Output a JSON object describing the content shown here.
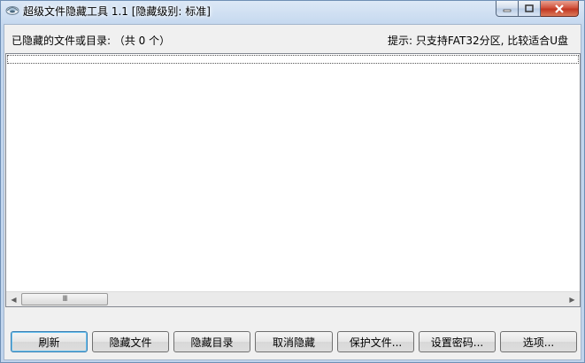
{
  "window": {
    "title": "超级文件隐藏工具 1.1  [隐藏级别: 标准]"
  },
  "header": {
    "hidden_label": "已隐藏的文件或目录: （共 0 个）",
    "hint": "提示: 只支持FAT32分区, 比较适合U盘"
  },
  "scrollbar": {
    "left_arrow": "◀",
    "right_arrow": "▶",
    "grip": "III"
  },
  "buttons": {
    "refresh": "刷新",
    "hide_file": "隐藏文件",
    "hide_dir": "隐藏目录",
    "unhide": "取消隐藏",
    "protect_file": "保护文件...",
    "set_password": "设置密码...",
    "options": "选项..."
  },
  "colors": {
    "close_button": "#c13722",
    "window_frame": "#c2d6ee"
  }
}
